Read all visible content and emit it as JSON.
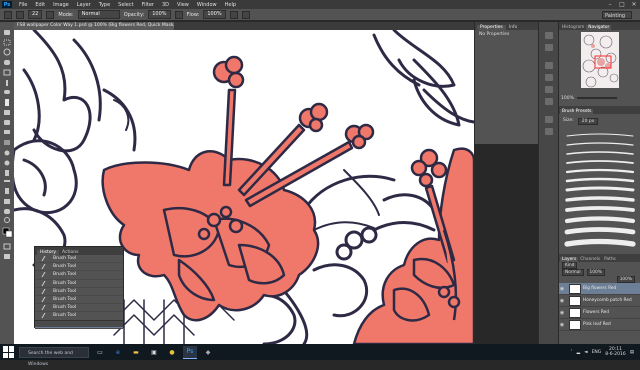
{
  "app": {
    "logo": "Ps"
  },
  "menu": [
    "File",
    "Edit",
    "Image",
    "Layer",
    "Type",
    "Select",
    "Filter",
    "3D",
    "View",
    "Window",
    "Help"
  ],
  "window_controls": {
    "minimize": "–",
    "maximize": "□",
    "close": "✕"
  },
  "options": {
    "size": "22",
    "mode_label": "Mode:",
    "mode_value": "Normal",
    "opacity_label": "Opacity:",
    "opacity_value": "100%",
    "flow_label": "Flow:",
    "flow_value": "100%",
    "workspace": "Painting"
  },
  "document": {
    "tab_title": "FS8 wallpaper Color Way 1.psd @ 100% (Big flowers Red, Quick Mask/8) *"
  },
  "history_panel": {
    "tabs": [
      "History",
      "Actions"
    ],
    "items": [
      "Brush Tool",
      "Brush Tool",
      "Brush Tool",
      "Brush Tool",
      "Brush Tool",
      "Brush Tool",
      "Brush Tool",
      "Brush Tool",
      "Brush Tool"
    ]
  },
  "properties_panel": {
    "tabs": [
      "Properties",
      "Info"
    ],
    "empty_text": "No Properties"
  },
  "navigator_panel": {
    "tabs": [
      "Histogram",
      "Navigator"
    ],
    "zoom": "100%"
  },
  "brush_panel": {
    "tabs": [
      "Brush Presets"
    ],
    "size_label": "Size:",
    "size_value": "20 px"
  },
  "layers_panel": {
    "tabs": [
      "Layers",
      "Channels",
      "Paths"
    ],
    "kind": "Kind",
    "blend": "Normal",
    "opacity": "100%",
    "fill": "100%",
    "items": [
      "Big flowers Red",
      "Honeycomb patch Red",
      "Flowers Red",
      "Pink leaf Red"
    ]
  },
  "taskbar": {
    "search_placeholder": "Search the web and Windows",
    "time": "20:11",
    "date": "8-6-2016",
    "lang": "ENG"
  },
  "colors": {
    "accent_flower": "#f0786a",
    "outline": "#2e2a45",
    "panel": "#535353",
    "selection": "#6d7f96"
  }
}
